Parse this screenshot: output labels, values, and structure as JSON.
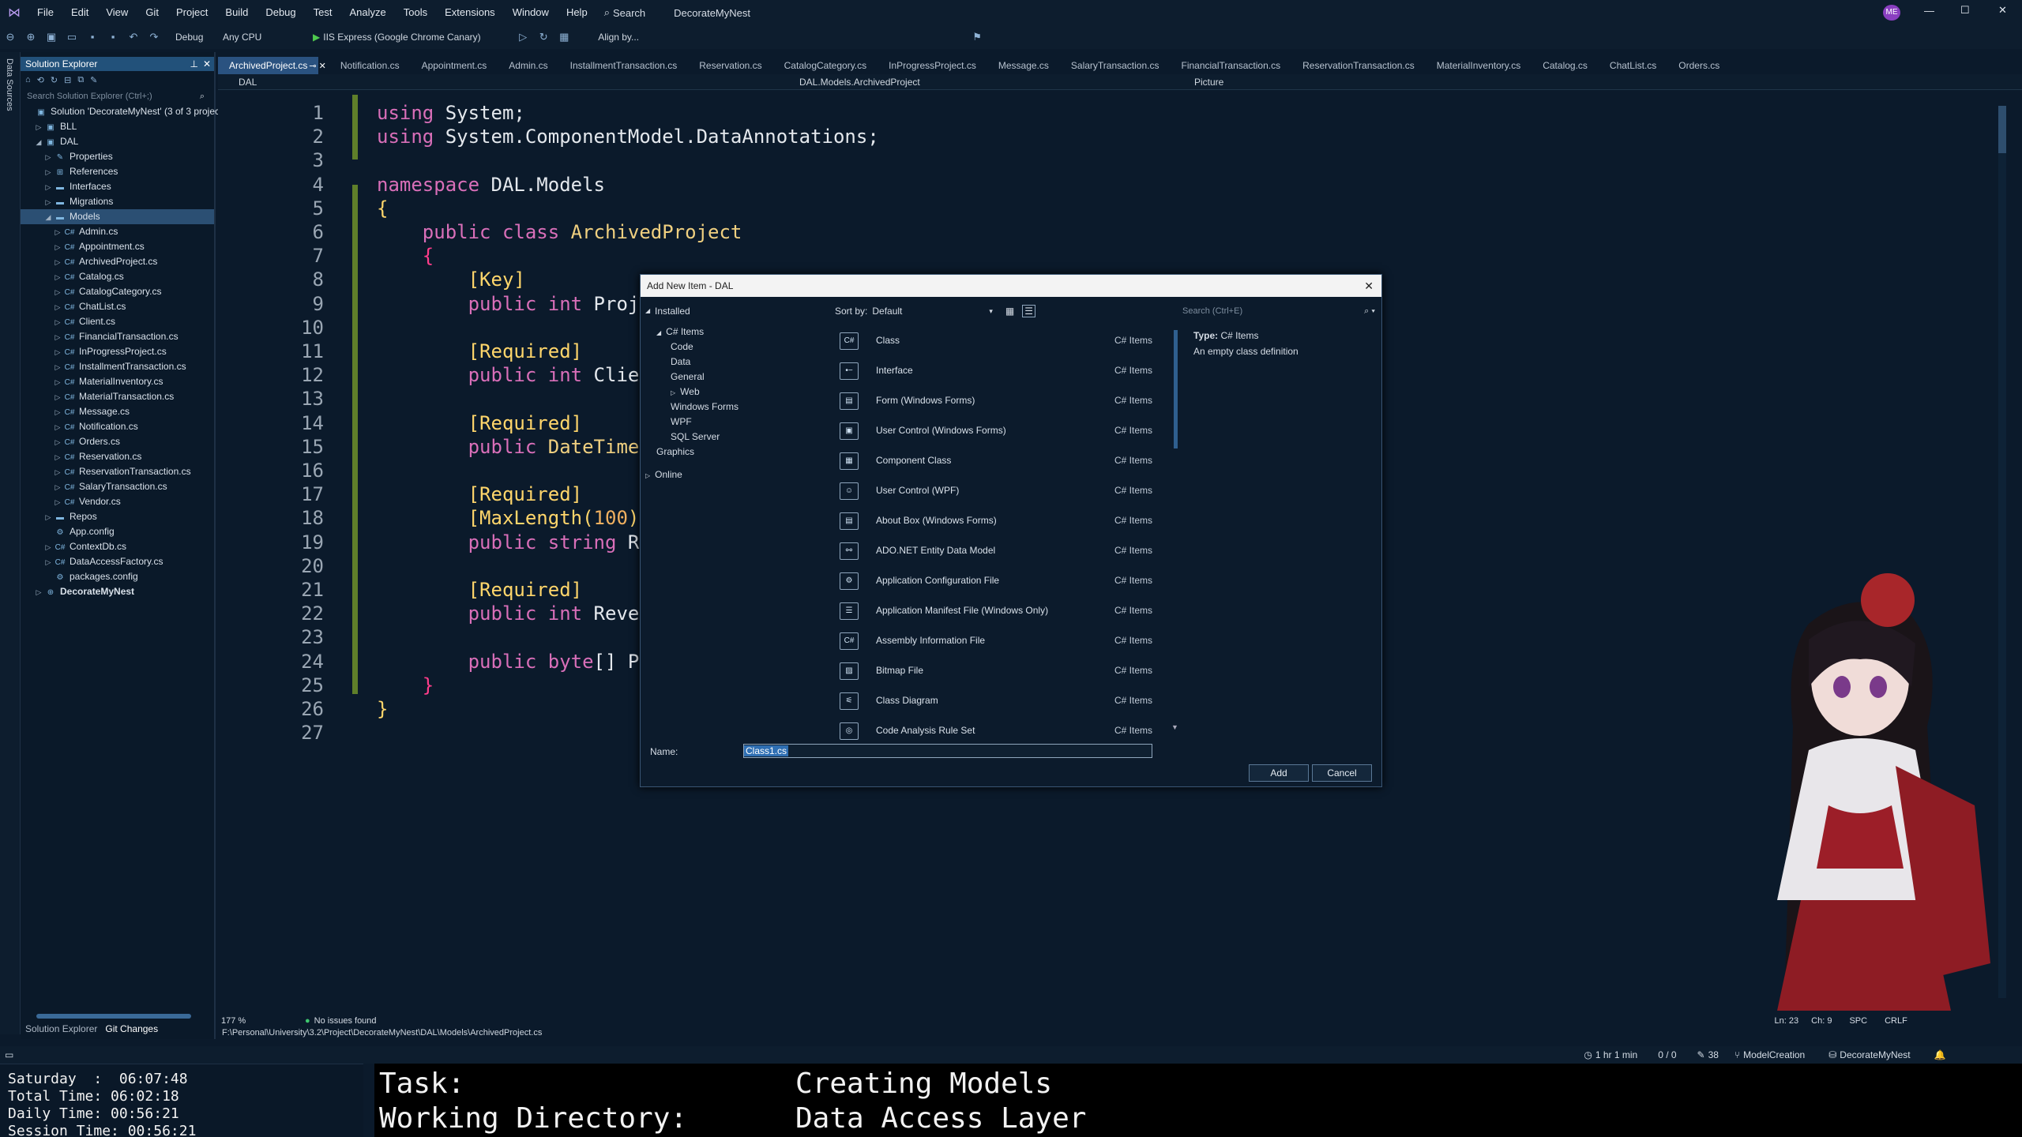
{
  "menu": [
    "File",
    "Edit",
    "View",
    "Git",
    "Project",
    "Build",
    "Debug",
    "Test",
    "Analyze",
    "Tools",
    "Extensions",
    "Window",
    "Help"
  ],
  "search_label": "Search",
  "solution_name": "DecorateMyNest",
  "user_badge": "ME",
  "toolbar": {
    "config": "Debug",
    "platform": "Any CPU",
    "run_target": "IIS Express (Google Chrome Canary)",
    "align": "Align by..."
  },
  "left_strip_label": "Data Sources",
  "solution_explorer": {
    "title": "Solution Explorer",
    "search_placeholder": "Search Solution Explorer (Ctrl+;)",
    "items": [
      {
        "label": "Solution 'DecorateMyNest' (3 of 3 projects)",
        "indent": 0,
        "caret": "",
        "icon": "▣"
      },
      {
        "label": "BLL",
        "indent": 1,
        "caret": "▷",
        "icon": "▣"
      },
      {
        "label": "DAL",
        "indent": 1,
        "caret": "◢",
        "icon": "▣"
      },
      {
        "label": "Properties",
        "indent": 2,
        "caret": "▷",
        "icon": "✎"
      },
      {
        "label": "References",
        "indent": 2,
        "caret": "▷",
        "icon": "⊞"
      },
      {
        "label": "Interfaces",
        "indent": 2,
        "caret": "▷",
        "icon": "▬"
      },
      {
        "label": "Migrations",
        "indent": 2,
        "caret": "▷",
        "icon": "▬"
      },
      {
        "label": "Models",
        "indent": 2,
        "caret": "◢",
        "icon": "▬",
        "selected": true
      },
      {
        "label": "Admin.cs",
        "indent": 3,
        "caret": "▷",
        "icon": "C#"
      },
      {
        "label": "Appointment.cs",
        "indent": 3,
        "caret": "▷",
        "icon": "C#"
      },
      {
        "label": "ArchivedProject.cs",
        "indent": 3,
        "caret": "▷",
        "icon": "C#"
      },
      {
        "label": "Catalog.cs",
        "indent": 3,
        "caret": "▷",
        "icon": "C#"
      },
      {
        "label": "CatalogCategory.cs",
        "indent": 3,
        "caret": "▷",
        "icon": "C#"
      },
      {
        "label": "ChatList.cs",
        "indent": 3,
        "caret": "▷",
        "icon": "C#"
      },
      {
        "label": "Client.cs",
        "indent": 3,
        "caret": "▷",
        "icon": "C#"
      },
      {
        "label": "FinancialTransaction.cs",
        "indent": 3,
        "caret": "▷",
        "icon": "C#"
      },
      {
        "label": "InProgressProject.cs",
        "indent": 3,
        "caret": "▷",
        "icon": "C#"
      },
      {
        "label": "InstallmentTransaction.cs",
        "indent": 3,
        "caret": "▷",
        "icon": "C#"
      },
      {
        "label": "MaterialInventory.cs",
        "indent": 3,
        "caret": "▷",
        "icon": "C#"
      },
      {
        "label": "MaterialTransaction.cs",
        "indent": 3,
        "caret": "▷",
        "icon": "C#"
      },
      {
        "label": "Message.cs",
        "indent": 3,
        "caret": "▷",
        "icon": "C#"
      },
      {
        "label": "Notification.cs",
        "indent": 3,
        "caret": "▷",
        "icon": "C#"
      },
      {
        "label": "Orders.cs",
        "indent": 3,
        "caret": "▷",
        "icon": "C#"
      },
      {
        "label": "Reservation.cs",
        "indent": 3,
        "caret": "▷",
        "icon": "C#"
      },
      {
        "label": "ReservationTransaction.cs",
        "indent": 3,
        "caret": "▷",
        "icon": "C#"
      },
      {
        "label": "SalaryTransaction.cs",
        "indent": 3,
        "caret": "▷",
        "icon": "C#"
      },
      {
        "label": "Vendor.cs",
        "indent": 3,
        "caret": "▷",
        "icon": "C#"
      },
      {
        "label": "Repos",
        "indent": 2,
        "caret": "▷",
        "icon": "▬"
      },
      {
        "label": "App.config",
        "indent": 2,
        "caret": "",
        "icon": "⚙"
      },
      {
        "label": "ContextDb.cs",
        "indent": 2,
        "caret": "▷",
        "icon": "C#"
      },
      {
        "label": "DataAccessFactory.cs",
        "indent": 2,
        "caret": "▷",
        "icon": "C#"
      },
      {
        "label": "packages.config",
        "indent": 2,
        "caret": "",
        "icon": "⚙"
      },
      {
        "label": "DecorateMyNest",
        "indent": 1,
        "caret": "▷",
        "icon": "⊕",
        "bold": true
      }
    ],
    "bottom_tabs": [
      "Solution Explorer",
      "Git Changes"
    ]
  },
  "tabs": [
    "ArchivedProject.cs",
    "Notification.cs",
    "Appointment.cs",
    "Admin.cs",
    "InstallmentTransaction.cs",
    "Reservation.cs",
    "CatalogCategory.cs",
    "InProgressProject.cs",
    "Message.cs",
    "SalaryTransaction.cs",
    "FinancialTransaction.cs",
    "ReservationTransaction.cs",
    "MaterialInventory.cs",
    "Catalog.cs",
    "ChatList.cs",
    "Orders.cs"
  ],
  "navbar": {
    "project": "DAL",
    "type": "DAL.Models.ArchivedProject",
    "member": "Picture"
  },
  "code_lines": [
    "1",
    "2",
    "3",
    "4",
    "5",
    "6",
    "7",
    "8",
    "9",
    "10",
    "11",
    "12",
    "13",
    "14",
    "15",
    "16",
    "17",
    "18",
    "19",
    "20",
    "21",
    "22",
    "23",
    "24",
    "25",
    "26",
    "27"
  ],
  "dialog": {
    "title": "Add New Item - DAL",
    "installed": "Installed",
    "sort_by_label": "Sort by:",
    "sort_by_value": "Default",
    "search_placeholder": "Search (Ctrl+E)",
    "categories": [
      "C# Items",
      "Code",
      "Data",
      "General",
      "Web",
      "Windows Forms",
      "WPF",
      "SQL Server",
      "Graphics",
      "Online"
    ],
    "templates": [
      {
        "name": "Class",
        "cat": "C# Items",
        "icon": "C#"
      },
      {
        "name": "Interface",
        "cat": "C# Items",
        "icon": "•−"
      },
      {
        "name": "Form (Windows Forms)",
        "cat": "C# Items",
        "icon": "▤"
      },
      {
        "name": "User Control (Windows Forms)",
        "cat": "C# Items",
        "icon": "▣"
      },
      {
        "name": "Component Class",
        "cat": "C# Items",
        "icon": "▦"
      },
      {
        "name": "User Control (WPF)",
        "cat": "C# Items",
        "icon": "☺"
      },
      {
        "name": "About Box (Windows Forms)",
        "cat": "C# Items",
        "icon": "▤"
      },
      {
        "name": "ADO.NET Entity Data Model",
        "cat": "C# Items",
        "icon": "⚯"
      },
      {
        "name": "Application Configuration File",
        "cat": "C# Items",
        "icon": "⚙"
      },
      {
        "name": "Application Manifest File (Windows Only)",
        "cat": "C# Items",
        "icon": "☰"
      },
      {
        "name": "Assembly Information File",
        "cat": "C# Items",
        "icon": "C#"
      },
      {
        "name": "Bitmap File",
        "cat": "C# Items",
        "icon": "▨"
      },
      {
        "name": "Class Diagram",
        "cat": "C# Items",
        "icon": "⚟"
      },
      {
        "name": "Code Analysis Rule Set",
        "cat": "C# Items",
        "icon": "◎"
      }
    ],
    "type_label": "Type:",
    "type_value": "C# Items",
    "description": "An empty class definition",
    "name_label": "Name:",
    "name_value": "Class1.cs",
    "add": "Add",
    "cancel": "Cancel"
  },
  "status": {
    "zoom": "177 %",
    "issues": "No issues found",
    "path": "F:\\Personal\\University\\3.2\\Project\\DecorateMyNest\\DAL\\Models\\ArchivedProject.cs",
    "ln": "Ln: 23",
    "ch": "Ch: 9",
    "spc": "SPC",
    "crlf": "CRLF",
    "time": "1 hr 1 min",
    "git_counts": "0 / 0",
    "edits": "38",
    "branch": "ModelCreation",
    "repo": "DecorateMyNest"
  },
  "timer": {
    "day": "Saturday  :  06:07:48",
    "total": "Total Time: 06:02:18",
    "daily": "Daily Time: 00:56:21",
    "session": "Session Time: 00:56:21"
  },
  "task": {
    "task_label": "Task:",
    "task_value": "Creating Models",
    "dir_label": "Working Directory:",
    "dir_value": "Data Access Layer"
  }
}
